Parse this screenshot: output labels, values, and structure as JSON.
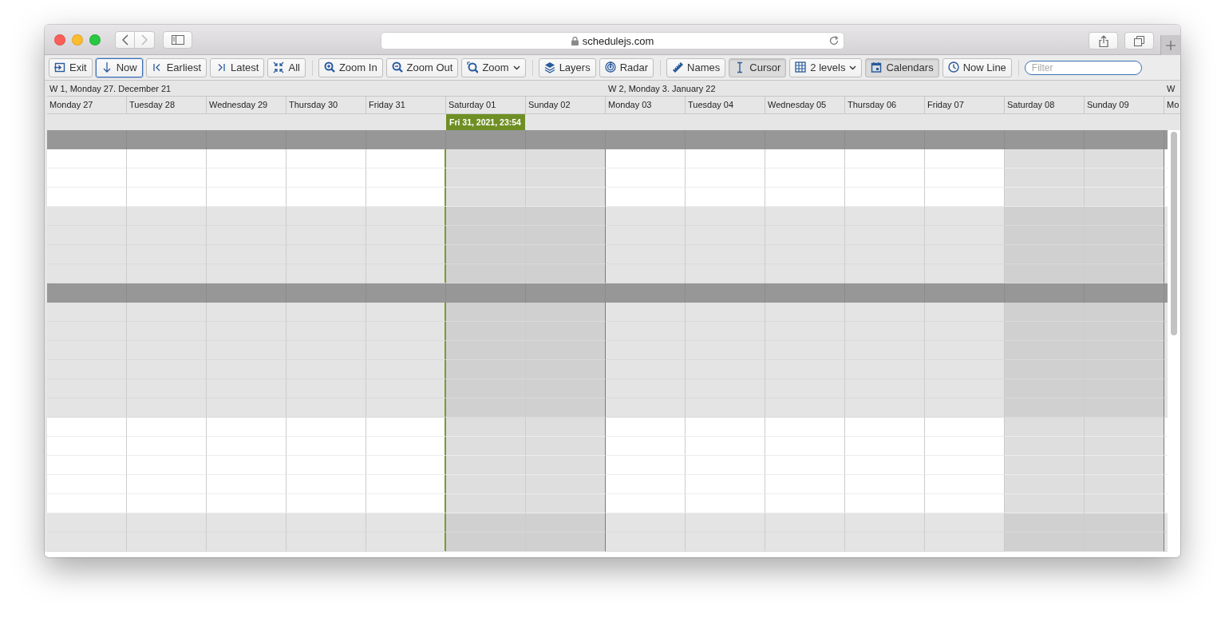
{
  "browser": {
    "url": "schedulejs.com"
  },
  "toolbar": {
    "groups": [
      [
        {
          "label": "Exit",
          "kind": "button",
          "focused": false,
          "pressed": false
        },
        {
          "label": "Now",
          "kind": "button",
          "focused": true,
          "pressed": false
        },
        {
          "label": "Earliest",
          "kind": "button",
          "focused": false,
          "pressed": false
        },
        {
          "label": "Latest",
          "kind": "button",
          "focused": false,
          "pressed": false
        },
        {
          "label": "All",
          "kind": "button",
          "focused": false,
          "pressed": false
        }
      ],
      [
        {
          "label": "Zoom In",
          "kind": "button",
          "focused": false,
          "pressed": false
        },
        {
          "label": "Zoom Out",
          "kind": "button",
          "focused": false,
          "pressed": false
        },
        {
          "label": "Zoom",
          "kind": "dropdown",
          "focused": false,
          "pressed": false
        }
      ],
      [
        {
          "label": "Layers",
          "kind": "button",
          "focused": false,
          "pressed": false
        },
        {
          "label": "Radar",
          "kind": "button",
          "focused": false,
          "pressed": false
        }
      ],
      [
        {
          "label": "Names",
          "kind": "button",
          "focused": false,
          "pressed": false
        },
        {
          "label": "Cursor",
          "kind": "button",
          "focused": false,
          "pressed": true
        },
        {
          "label": "2 levels",
          "kind": "dropdown",
          "focused": false,
          "pressed": false
        },
        {
          "label": "Calendars",
          "kind": "button",
          "focused": false,
          "pressed": true
        },
        {
          "label": "Now Line",
          "kind": "button",
          "focused": false,
          "pressed": false
        }
      ]
    ],
    "filter": {
      "placeholder": "Filter"
    }
  },
  "timeline": {
    "weeks": [
      {
        "label": "W 1, Monday 27. December 21",
        "days": [
          {
            "label": "Monday 27",
            "weekend": false,
            "now_line": false
          },
          {
            "label": "Tuesday 28",
            "weekend": false,
            "now_line": false
          },
          {
            "label": "Wednesday 29",
            "weekend": false,
            "now_line": false
          },
          {
            "label": "Thursday 30",
            "weekend": false,
            "now_line": false
          },
          {
            "label": "Friday 31",
            "weekend": false,
            "now_line": true
          },
          {
            "label": "Saturday 01",
            "weekend": true,
            "now_line": false
          },
          {
            "label": "Sunday 02",
            "weekend": true,
            "now_line": false
          }
        ]
      },
      {
        "label": "W 2, Monday 3. January 22",
        "days": [
          {
            "label": "Monday 03",
            "weekend": false,
            "now_line": false
          },
          {
            "label": "Tuesday 04",
            "weekend": false,
            "now_line": false
          },
          {
            "label": "Wednesday 05",
            "weekend": false,
            "now_line": false
          },
          {
            "label": "Thursday 06",
            "weekend": false,
            "now_line": false
          },
          {
            "label": "Friday 07",
            "weekend": false,
            "now_line": false
          },
          {
            "label": "Saturday 08",
            "weekend": true,
            "now_line": false
          },
          {
            "label": "Sunday 09",
            "weekend": true,
            "now_line": false
          }
        ]
      },
      {
        "label": "W",
        "days": [
          {
            "label": "Mo",
            "weekend": false,
            "now_line": false
          }
        ]
      }
    ],
    "now_marker": {
      "label": "Fri 31, 2021, 23:54"
    },
    "rows": [
      {
        "kind": "group"
      },
      {
        "kind": "row",
        "shaded": false
      },
      {
        "kind": "row",
        "shaded": false
      },
      {
        "kind": "row",
        "shaded": false
      },
      {
        "kind": "row",
        "shaded": true
      },
      {
        "kind": "row",
        "shaded": true
      },
      {
        "kind": "row",
        "shaded": true
      },
      {
        "kind": "row",
        "shaded": true
      },
      {
        "kind": "group"
      },
      {
        "kind": "row",
        "shaded": true
      },
      {
        "kind": "row",
        "shaded": true
      },
      {
        "kind": "row",
        "shaded": true
      },
      {
        "kind": "row",
        "shaded": true
      },
      {
        "kind": "row",
        "shaded": true
      },
      {
        "kind": "row",
        "shaded": true
      },
      {
        "kind": "row",
        "shaded": false
      },
      {
        "kind": "row",
        "shaded": false
      },
      {
        "kind": "row",
        "shaded": false
      },
      {
        "kind": "row",
        "shaded": false
      },
      {
        "kind": "row",
        "shaded": false
      },
      {
        "kind": "row",
        "shaded": true
      },
      {
        "kind": "row",
        "shaded": true
      }
    ]
  }
}
